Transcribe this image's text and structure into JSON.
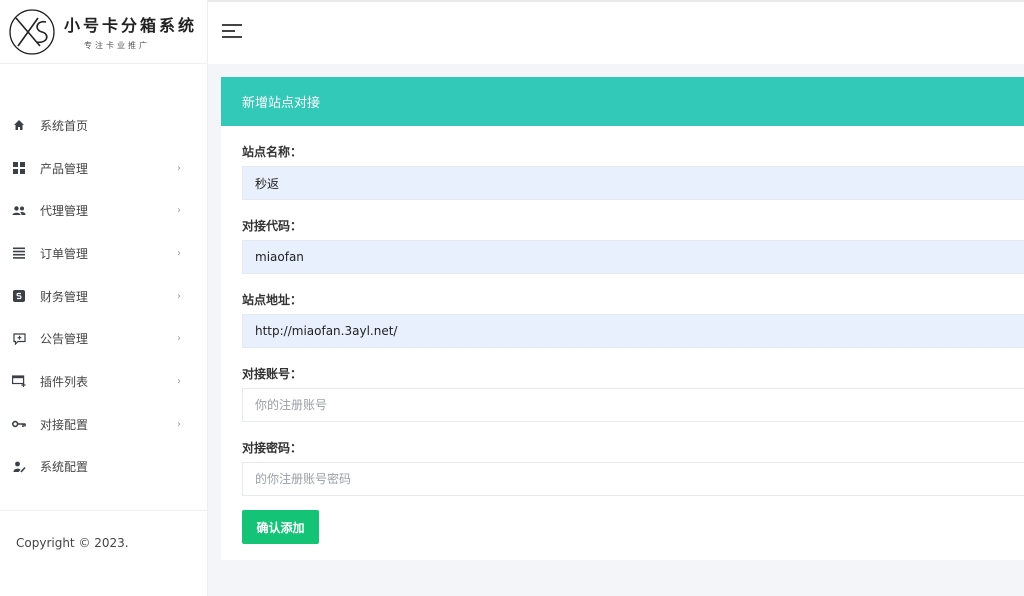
{
  "brand": {
    "logo_initials": "XS",
    "title": "小号卡分箱系统",
    "subtitle": "专注卡业推广"
  },
  "sidebar": {
    "items": [
      {
        "label": "系统首页",
        "icon": "home-icon",
        "has_children": false
      },
      {
        "label": "产品管理",
        "icon": "grid-icon",
        "has_children": true
      },
      {
        "label": "代理管理",
        "icon": "users-icon",
        "has_children": true
      },
      {
        "label": "订单管理",
        "icon": "list-icon",
        "has_children": true
      },
      {
        "label": "财务管理",
        "icon": "dollar-icon",
        "has_children": true
      },
      {
        "label": "公告管理",
        "icon": "announcement-icon",
        "has_children": true
      },
      {
        "label": "插件列表",
        "icon": "plugin-icon",
        "has_children": true
      },
      {
        "label": "对接配置",
        "icon": "key-icon",
        "has_children": true
      },
      {
        "label": "系统配置",
        "icon": "user-settings-icon",
        "has_children": false
      }
    ],
    "chevron": "›"
  },
  "footer": {
    "copyright": "Copyright © 2023."
  },
  "form": {
    "title": "新增站点对接",
    "fields": [
      {
        "label": "站点名称：",
        "value": "秒返",
        "placeholder": ""
      },
      {
        "label": "对接代码：",
        "value": "miaofan",
        "placeholder": ""
      },
      {
        "label": "站点地址：",
        "value": "http://miaofan.3ayl.net/",
        "placeholder": ""
      },
      {
        "label": "对接账号：",
        "value": "",
        "placeholder": "你的注册账号"
      },
      {
        "label": "对接密码：",
        "value": "",
        "placeholder": "的你注册账号密码"
      }
    ],
    "submit_label": "确认添加"
  },
  "colors": {
    "header_teal": "#33c9b9",
    "submit_green": "#15c377",
    "autofill_blue": "#e8f0fe"
  }
}
